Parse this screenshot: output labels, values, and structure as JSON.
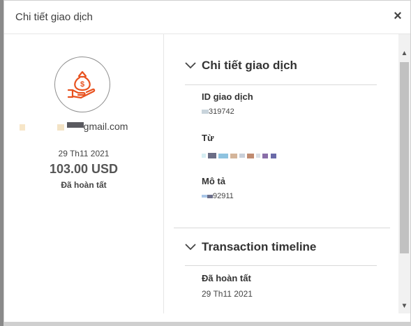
{
  "dialog": {
    "title": "Chi tiết giao dịch",
    "close_glyph": "×"
  },
  "summary": {
    "icon": "money-bag-hand-icon",
    "accent_color": "#e8521f",
    "email_suffix": "gmail.com",
    "date": "29 Th11 2021",
    "amount": "103.00 USD",
    "status": "Đã hoàn tất"
  },
  "details": {
    "section_title": "Chi tiết giao dịch",
    "fields": [
      {
        "label": "ID giao dịch",
        "value": "319742"
      },
      {
        "label": "Từ",
        "value": ""
      },
      {
        "label": "Mô tả",
        "value": "92911"
      }
    ]
  },
  "timeline": {
    "section_title": "Transaction timeline",
    "status": "Đã hoàn tất",
    "date": "29 Th11 2021"
  },
  "scrollbar": {
    "up_glyph": "▲",
    "down_glyph": "▼"
  }
}
